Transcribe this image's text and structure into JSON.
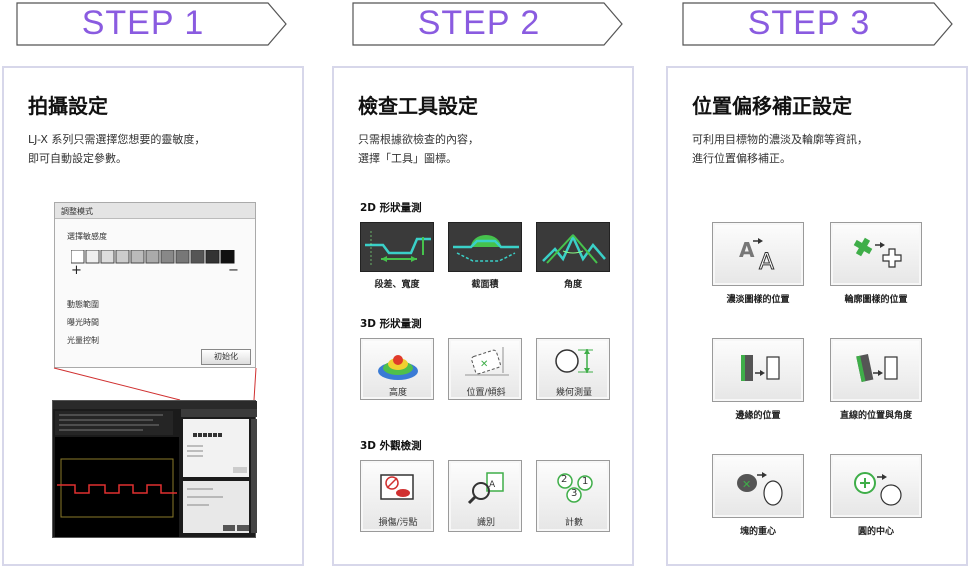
{
  "steps": [
    {
      "label": "STEP 1"
    },
    {
      "label": "STEP 2"
    },
    {
      "label": "STEP 3"
    }
  ],
  "step1": {
    "title": "拍攝設定",
    "desc": "LJ-X 系列只需選擇您想要的靈敏度，\n即可自動設定參數。",
    "panel": {
      "header": "調整模式",
      "sensitivity_label": "選擇敏感度",
      "plus": "+",
      "minus": "−",
      "options": [
        "動態範圍",
        "曝光時間",
        "光量控制"
      ],
      "init_button": "初始化"
    }
  },
  "step2": {
    "title": "檢查工具設定",
    "desc": "只需根據欲檢查的內容，\n選擇「工具」圖標。",
    "section_2d": "2D 形狀量測",
    "section_3d": "3D 形狀量測",
    "section_3dv": "3D 外觀檢測",
    "tools_2d": [
      {
        "label": "段差、寬度",
        "icon": "step-width-icon"
      },
      {
        "label": "截面積",
        "icon": "cross-section-icon"
      },
      {
        "label": "角度",
        "icon": "angle-icon"
      }
    ],
    "tools_3d": [
      {
        "label": "高度",
        "icon": "height-icon"
      },
      {
        "label": "位置/傾斜",
        "icon": "position-tilt-icon"
      },
      {
        "label": "幾何測量",
        "icon": "geometry-icon"
      }
    ],
    "tools_3dv": [
      {
        "label": "損傷/污點",
        "icon": "damage-icon"
      },
      {
        "label": "識別",
        "icon": "identify-icon"
      },
      {
        "label": "計數",
        "icon": "count-icon"
      }
    ],
    "count_digits": [
      "2",
      "1",
      "3"
    ]
  },
  "step3": {
    "title": "位置偏移補正設定",
    "desc": "可利用目標物的濃淡及輪廓等資訊，\n進行位置偏移補正。",
    "tools": [
      {
        "label": "濃淡圖樣的位置",
        "icon": "shade-pattern-icon"
      },
      {
        "label": "輪廓圖樣的位置",
        "icon": "contour-pattern-icon"
      },
      {
        "label": "邊緣的位置",
        "icon": "edge-position-icon"
      },
      {
        "label": "直線的位置與角度",
        "icon": "line-angle-icon"
      },
      {
        "label": "塊的重心",
        "icon": "blob-centroid-icon"
      },
      {
        "label": "圓的中心",
        "icon": "circle-center-icon"
      }
    ]
  },
  "colors": {
    "accent": "#8a5be0",
    "card_border": "#d7d7ea",
    "teal": "#2ab5b0",
    "green": "#3fae49",
    "red": "#d03030"
  }
}
